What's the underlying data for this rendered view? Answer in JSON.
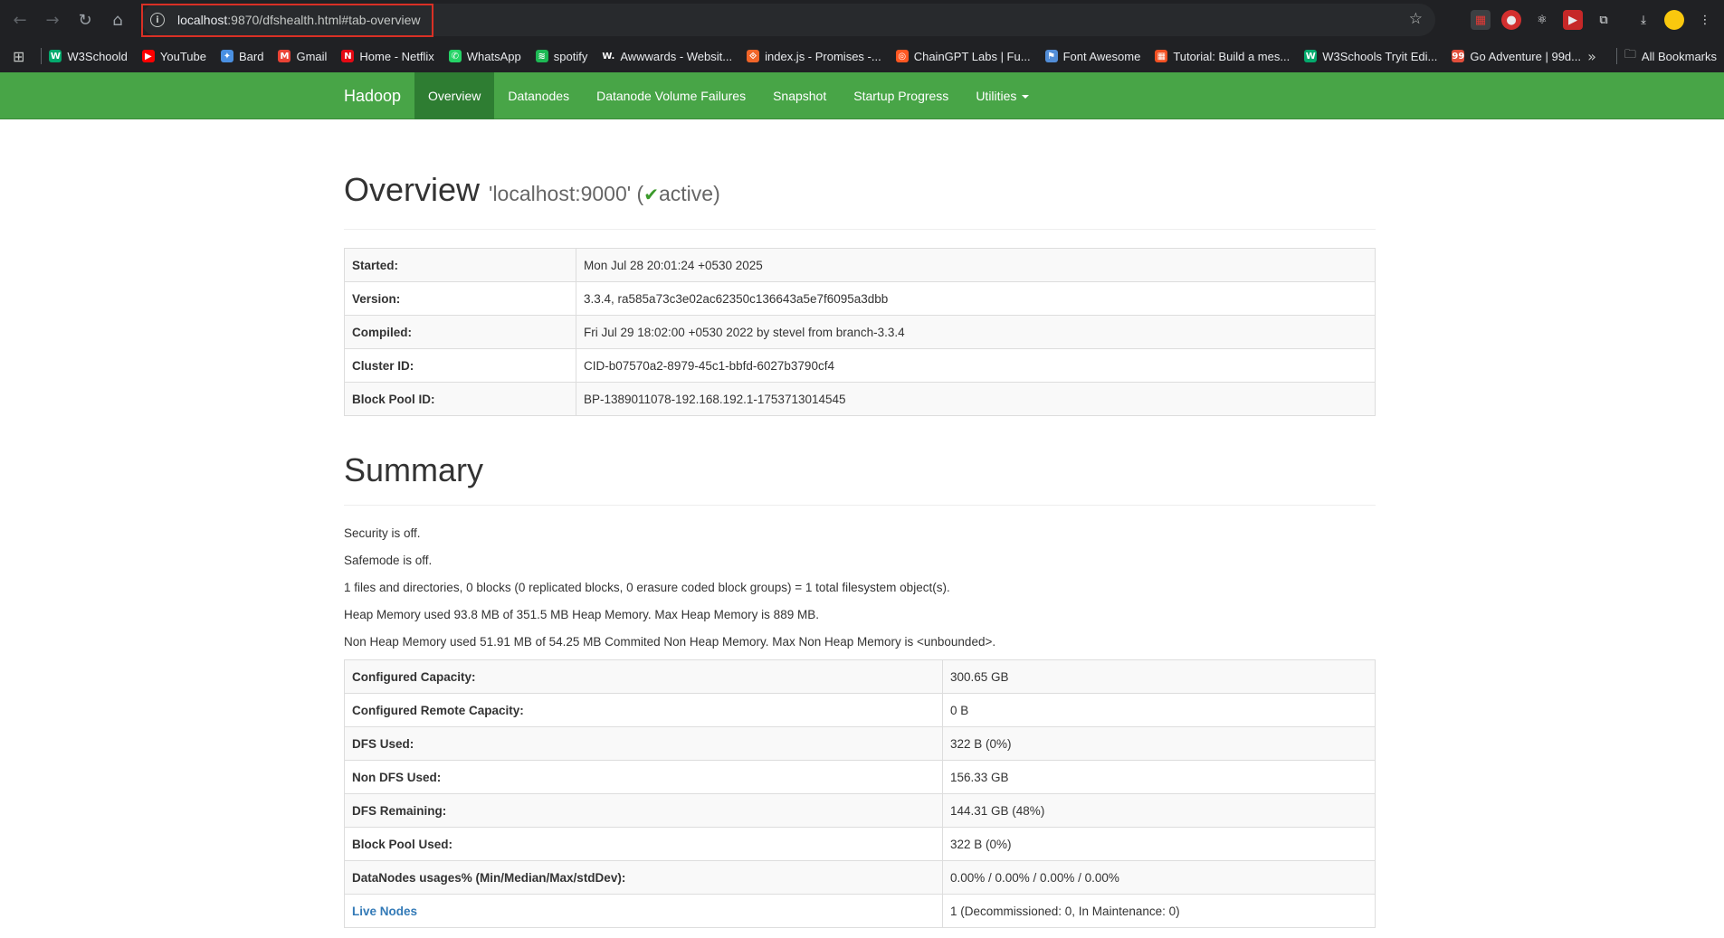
{
  "browser": {
    "url_host": "localhost",
    "url_path": ":9870/dfshealth.html#tab-overview",
    "bookmarks": [
      {
        "label": "W3Schoold",
        "icon": "w3schools-icon",
        "color": "#04aa6d",
        "glyph": "W"
      },
      {
        "label": "YouTube",
        "icon": "youtube-icon",
        "color": "#ff0000",
        "glyph": "▶"
      },
      {
        "label": "Bard",
        "icon": "bard-sparkle-icon",
        "color": "#4a90e2",
        "glyph": "✦"
      },
      {
        "label": "Gmail",
        "icon": "gmail-icon",
        "color": "#ea4335",
        "glyph": "M"
      },
      {
        "label": "Home - Netflix",
        "icon": "netflix-icon",
        "color": "#e50914",
        "glyph": "N"
      },
      {
        "label": "WhatsApp",
        "icon": "whatsapp-icon",
        "color": "#25d366",
        "glyph": "✆"
      },
      {
        "label": "spotify",
        "icon": "spotify-icon",
        "color": "#1db954",
        "glyph": "≋"
      },
      {
        "label": "Awwwards - Websit...",
        "icon": "awwwards-icon",
        "color": "#202124",
        "glyph": "W."
      },
      {
        "label": "index.js - Promises -...",
        "icon": "codesandbox-icon",
        "color": "#f06529",
        "glyph": "⟐"
      },
      {
        "label": "ChainGPT Labs | Fu...",
        "icon": "chaingpt-icon",
        "color": "#ff5722",
        "glyph": "◎"
      },
      {
        "label": "Font Awesome",
        "icon": "font-awesome-flag-icon",
        "color": "#528dd7",
        "glyph": "⚑"
      },
      {
        "label": "Tutorial: Build a mes...",
        "icon": "microsoft-icon",
        "color": "#f25022",
        "glyph": "▦"
      },
      {
        "label": "W3Schools Tryit Edi...",
        "icon": "w3schools-icon",
        "color": "#04aa6d",
        "glyph": "W"
      },
      {
        "label": "Go Adventure | 99d...",
        "icon": "99designs-icon",
        "color": "#e24e3b",
        "glyph": "99"
      }
    ],
    "all_bookmarks_label": "All Bookmarks"
  },
  "navbar": {
    "brand": "Hadoop",
    "items": [
      "Overview",
      "Datanodes",
      "Datanode Volume Failures",
      "Snapshot",
      "Startup Progress",
      "Utilities"
    ],
    "active": "Overview",
    "color": "#48a547"
  },
  "overview": {
    "title": "Overview",
    "host": "'localhost:9000' (",
    "status": "active",
    "close": ")",
    "rows": [
      {
        "key": "Started:",
        "value": "Mon Jul 28 20:01:24 +0530 2025"
      },
      {
        "key": "Version:",
        "value": "3.3.4, ra585a73c3e02ac62350c136643a5e7f6095a3dbb"
      },
      {
        "key": "Compiled:",
        "value": "Fri Jul 29 18:02:00 +0530 2022 by stevel from branch-3.3.4"
      },
      {
        "key": "Cluster ID:",
        "value": "CID-b07570a2-8979-45c1-bbfd-6027b3790cf4"
      },
      {
        "key": "Block Pool ID:",
        "value": "BP-1389011078-192.168.192.1-1753713014545"
      }
    ]
  },
  "summary": {
    "title": "Summary",
    "lines": [
      "Security is off.",
      "Safemode is off.",
      "1 files and directories, 0 blocks (0 replicated blocks, 0 erasure coded block groups) = 1 total filesystem object(s).",
      "Heap Memory used 93.8 MB of 351.5 MB Heap Memory. Max Heap Memory is 889 MB.",
      "Non Heap Memory used 51.91 MB of 54.25 MB Commited Non Heap Memory. Max Non Heap Memory is <unbounded>."
    ],
    "rows": [
      {
        "key": "Configured Capacity:",
        "value": "300.65 GB"
      },
      {
        "key": "Configured Remote Capacity:",
        "value": "0 B"
      },
      {
        "key": "DFS Used:",
        "value": "322 B (0%)"
      },
      {
        "key": "Non DFS Used:",
        "value": "156.33 GB"
      },
      {
        "key": "DFS Remaining:",
        "value": "144.31 GB (48%)"
      },
      {
        "key": "Block Pool Used:",
        "value": "322 B (0%)"
      },
      {
        "key": "DataNodes usages% (Min/Median/Max/stdDev):",
        "value": "0.00% / 0.00% / 0.00% / 0.00%"
      },
      {
        "key": "Live Nodes",
        "value": "1 (Decommissioned: 0, In Maintenance: 0)",
        "link": true
      }
    ]
  }
}
